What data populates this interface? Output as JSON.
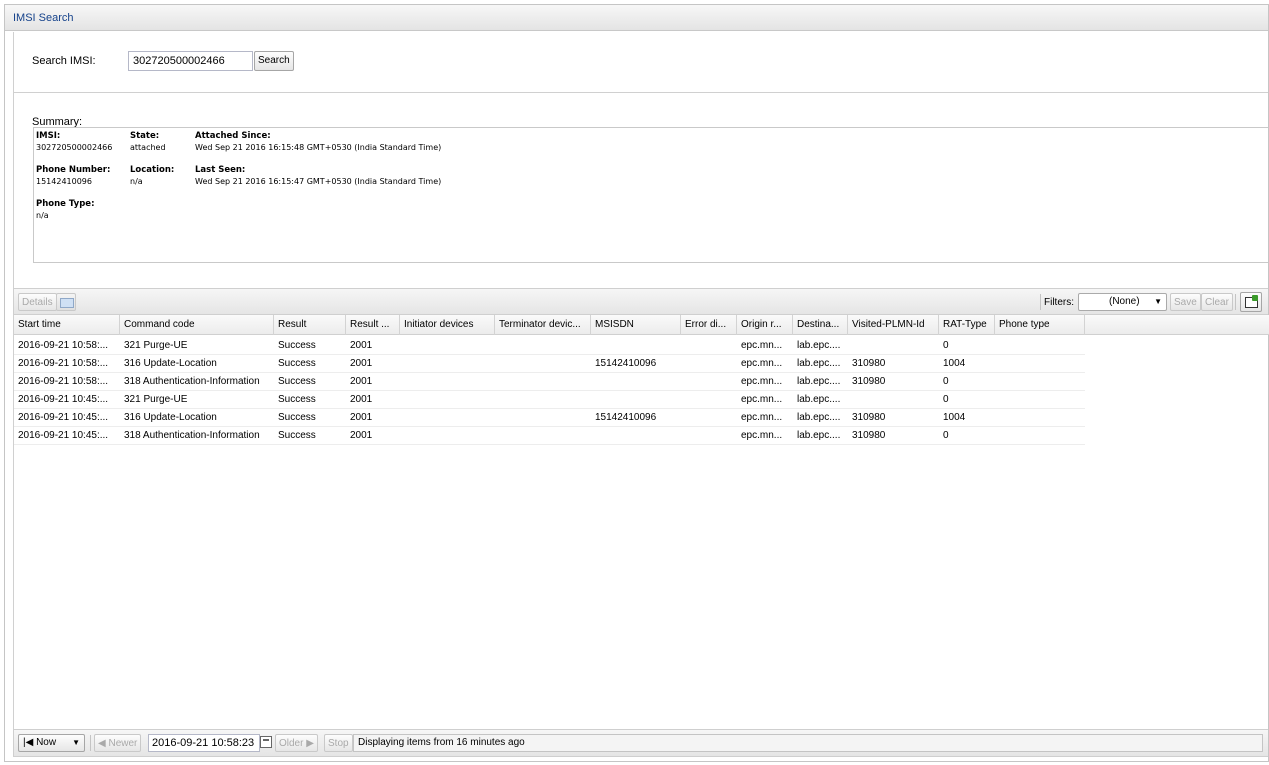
{
  "window": {
    "title": "IMSI Search"
  },
  "search": {
    "label": "Search IMSI:",
    "value": "302720500002466",
    "button": "Search"
  },
  "summary": {
    "label": "Summary:",
    "imsi_label": "IMSI:",
    "imsi_value": "302720500002466",
    "state_label": "State:",
    "state_value": "attached",
    "attached_label": "Attached Since:",
    "attached_value": "Wed Sep 21 2016 16:15:48 GMT+0530 (India Standard Time)",
    "phone_label": "Phone Number:",
    "phone_value": "15142410096",
    "location_label": "Location:",
    "location_value": "n/a",
    "lastseen_label": "Last Seen:",
    "lastseen_value": "Wed Sep 21 2016 16:15:47 GMT+0530 (India Standard Time)",
    "phonetype_label": "Phone Type:",
    "phonetype_value": "n/a"
  },
  "toolbar": {
    "details": "Details",
    "filters_label": "Filters:",
    "filters_value": "(None)",
    "save": "Save",
    "clear": "Clear"
  },
  "grid": {
    "columns": [
      "Start time",
      "Command code",
      "Result",
      "Result ...",
      "Initiator devices",
      "Terminator devic...",
      "MSISDN",
      "Error di...",
      "Origin r...",
      "Destina...",
      "Visited-PLMN-Id",
      "RAT-Type",
      "Phone type"
    ],
    "rows": [
      [
        "2016-09-21 10:58:...",
        "321 Purge-UE",
        "Success",
        "2001",
        "",
        "",
        "",
        "",
        "epc.mn...",
        "lab.epc....",
        "",
        "0",
        ""
      ],
      [
        "2016-09-21 10:58:...",
        "316 Update-Location",
        "Success",
        "2001",
        "",
        "",
        "15142410096",
        "",
        "epc.mn...",
        "lab.epc....",
        "310980",
        "1004",
        ""
      ],
      [
        "2016-09-21 10:58:...",
        "318 Authentication-Information",
        "Success",
        "2001",
        "",
        "",
        "",
        "",
        "epc.mn...",
        "lab.epc....",
        "310980",
        "0",
        ""
      ],
      [
        "2016-09-21 10:45:...",
        "321 Purge-UE",
        "Success",
        "2001",
        "",
        "",
        "",
        "",
        "epc.mn...",
        "lab.epc....",
        "",
        "0",
        ""
      ],
      [
        "2016-09-21 10:45:...",
        "316 Update-Location",
        "Success",
        "2001",
        "",
        "",
        "15142410096",
        "",
        "epc.mn...",
        "lab.epc....",
        "310980",
        "1004",
        ""
      ],
      [
        "2016-09-21 10:45:...",
        "318 Authentication-Information",
        "Success",
        "2001",
        "",
        "",
        "",
        "",
        "epc.mn...",
        "lab.epc....",
        "310980",
        "0",
        ""
      ]
    ]
  },
  "paging": {
    "now": "Now",
    "newer": "Newer",
    "date": "2016-09-21 10:58:23",
    "older": "Older",
    "stop": "Stop",
    "status": "Displaying items from 16 minutes ago"
  }
}
